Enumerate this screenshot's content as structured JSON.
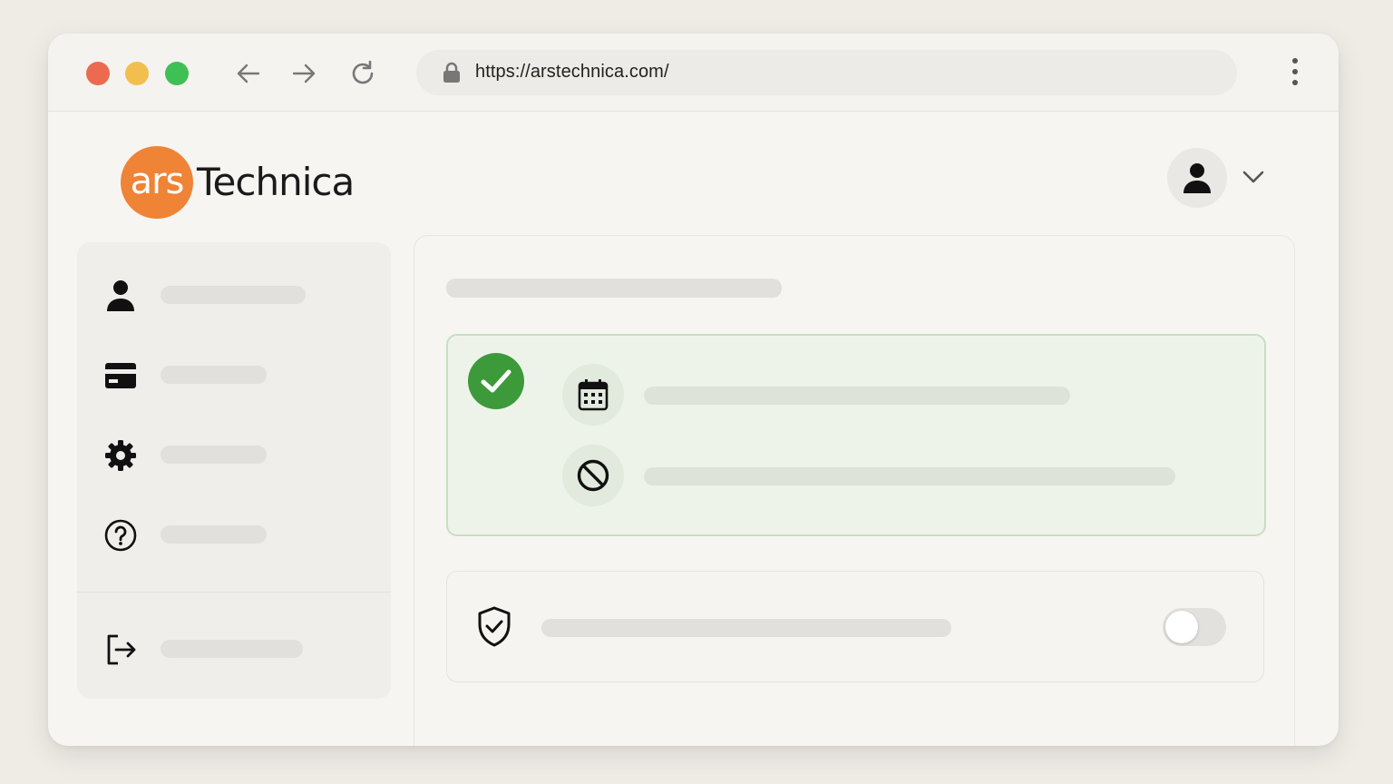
{
  "browser": {
    "url": "https://arstechnica.com/",
    "traffic_lights": [
      "#ec6a4f",
      "#f2bf4f",
      "#3fc055"
    ]
  },
  "logo": {
    "mark_text": "ars",
    "word_text": "Technica",
    "brand_color": "#ef8336"
  },
  "header": {
    "avatar_icon": "user-icon",
    "menu_icon": "chevron-down-icon"
  },
  "sidebar": {
    "items": [
      {
        "icon": "user-icon"
      },
      {
        "icon": "credit-card-icon"
      },
      {
        "icon": "gear-icon"
      },
      {
        "icon": "help-circle-icon"
      }
    ],
    "footer_item": {
      "icon": "logout-icon"
    }
  },
  "main": {
    "status_card": {
      "status_icon": "check-circle-icon",
      "status_color": "#3c9a3a",
      "rows": [
        {
          "icon": "calendar-icon"
        },
        {
          "icon": "block-icon"
        }
      ]
    },
    "toggle_card": {
      "icon": "shield-check-icon",
      "toggle_on": false
    }
  }
}
